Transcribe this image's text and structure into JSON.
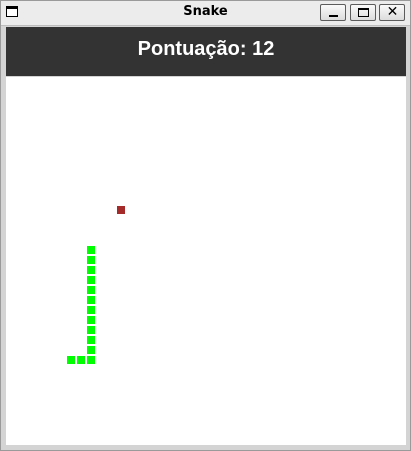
{
  "window": {
    "title": "Snake",
    "minimize_icon": "minimize-icon",
    "maximize_icon": "maximize-icon",
    "close_icon": "close-icon",
    "close_glyph": "✕"
  },
  "game": {
    "score_text": "Pontuação: 12",
    "score": 12,
    "grid_step": 10,
    "food": {
      "col": 13,
      "row": 13
    },
    "snake": [
      {
        "col": 10,
        "row": 17
      },
      {
        "col": 10,
        "row": 18
      },
      {
        "col": 10,
        "row": 19
      },
      {
        "col": 10,
        "row": 20
      },
      {
        "col": 10,
        "row": 21
      },
      {
        "col": 10,
        "row": 22
      },
      {
        "col": 10,
        "row": 23
      },
      {
        "col": 10,
        "row": 24
      },
      {
        "col": 10,
        "row": 25
      },
      {
        "col": 10,
        "row": 26
      },
      {
        "col": 10,
        "row": 27
      },
      {
        "col": 10,
        "row": 28
      },
      {
        "col": 9,
        "row": 28
      },
      {
        "col": 8,
        "row": 28
      }
    ],
    "colors": {
      "snake": "#00ff00",
      "food": "#a52a2a",
      "header": "#333333",
      "board": "#ffffff"
    }
  }
}
